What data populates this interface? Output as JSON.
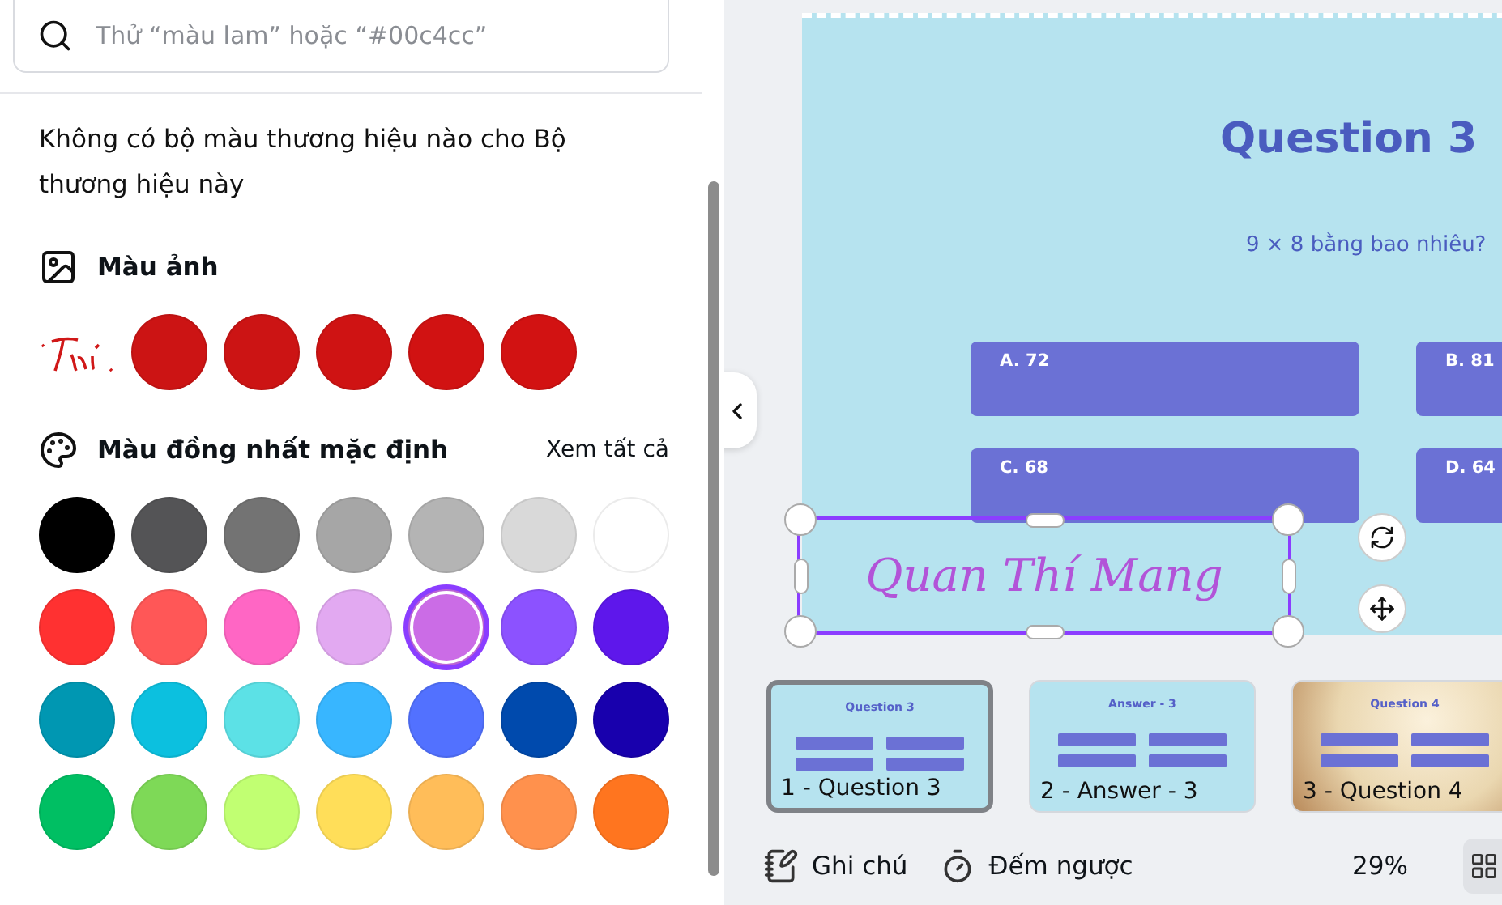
{
  "search": {
    "placeholder": "Thử “màu lam” hoặc “#00c4cc”"
  },
  "brand_notice": "Không có bộ màu thương hiệu nào cho Bộ thương hiệu này",
  "photo_colors": {
    "title": "Màu ảnh",
    "swatches": [
      {
        "color": "#cc1414"
      },
      {
        "color": "#cc1414"
      },
      {
        "color": "#cf1313"
      },
      {
        "color": "#d11212"
      },
      {
        "color": "#d21212"
      }
    ]
  },
  "default_colors": {
    "title": "Màu đồng nhất mặc định",
    "see_all": "Xem tất cả",
    "swatches": [
      {
        "color": "#000000",
        "selected": false
      },
      {
        "color": "#545456",
        "selected": false
      },
      {
        "color": "#737373",
        "selected": false
      },
      {
        "color": "#a6a6a6",
        "selected": false
      },
      {
        "color": "#b4b4b4",
        "selected": false
      },
      {
        "color": "#d9d9d9",
        "selected": false
      },
      {
        "color": "#ffffff",
        "selected": false
      },
      {
        "color": "#ff3131",
        "selected": false
      },
      {
        "color": "#ff5757",
        "selected": false
      },
      {
        "color": "#ff66c4",
        "selected": false
      },
      {
        "color": "#e2a9f1",
        "selected": false
      },
      {
        "color": "#cb6ce6",
        "selected": true
      },
      {
        "color": "#8c52ff",
        "selected": false
      },
      {
        "color": "#5e17eb",
        "selected": false
      },
      {
        "color": "#0097b2",
        "selected": false
      },
      {
        "color": "#0cc0df",
        "selected": false
      },
      {
        "color": "#5ce1e6",
        "selected": false
      },
      {
        "color": "#38b6ff",
        "selected": false
      },
      {
        "color": "#5271ff",
        "selected": false
      },
      {
        "color": "#004aad",
        "selected": false
      },
      {
        "color": "#1800ad",
        "selected": false
      },
      {
        "color": "#00bf63",
        "selected": false
      },
      {
        "color": "#7ed957",
        "selected": false
      },
      {
        "color": "#c1ff72",
        "selected": false
      },
      {
        "color": "#ffde59",
        "selected": false
      },
      {
        "color": "#ffbd59",
        "selected": false
      },
      {
        "color": "#ff914d",
        "selected": false
      },
      {
        "color": "#ff751f",
        "selected": false
      }
    ]
  },
  "slide": {
    "title": "Question 3",
    "question": "9 × 8 bằng bao nhiêu?",
    "answers": [
      "A. 72",
      "B. 81",
      "C. 68",
      "D. 64"
    ],
    "signature": "Quan Thí Mang"
  },
  "pages": [
    {
      "label": "1 - Question 3",
      "title": "Question 3",
      "kind": "plain",
      "selected": true
    },
    {
      "label": "2 - Answer - 3",
      "title": "Answer - 3",
      "kind": "plain",
      "selected": false
    },
    {
      "label": "3 - Question 4",
      "title": "Question 4",
      "kind": "photo",
      "selected": false
    }
  ],
  "footer": {
    "notes": "Ghi chú",
    "timer": "Đếm ngược",
    "zoom": "29%"
  }
}
